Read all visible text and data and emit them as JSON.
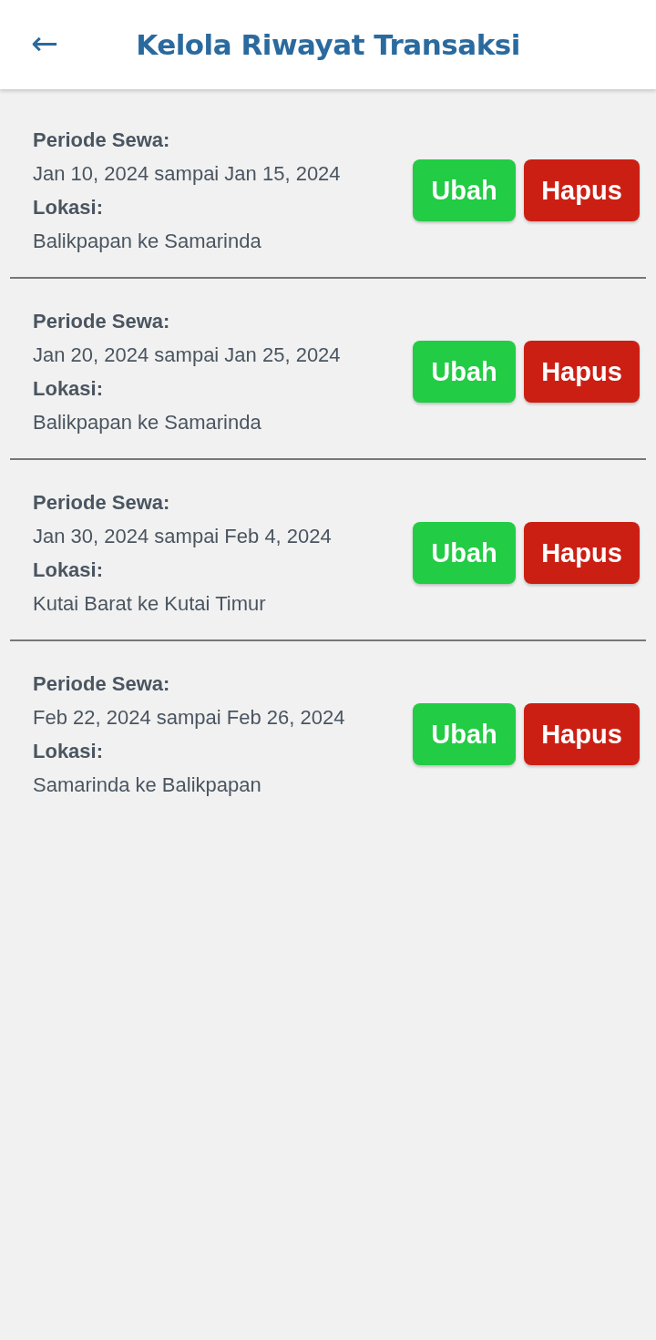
{
  "header": {
    "back_icon": "←",
    "title": "Kelola Riwayat Transaksi"
  },
  "transactions": [
    {
      "period_label": "Periode Sewa:",
      "period": "Jan 10, 2024 sampai Jan 15, 2024",
      "location_label": "Lokasi:",
      "location": "Balikpapan ke Samarinda",
      "edit_button": "Ubah",
      "delete_button": "Hapus"
    },
    {
      "period_label": "Periode Sewa:",
      "period": "Jan 20, 2024 sampai Jan 25, 2024",
      "location_label": "Lokasi:",
      "location": "Balikpapan ke Samarinda",
      "edit_button": "Ubah",
      "delete_button": "Hapus"
    },
    {
      "period_label": "Periode Sewa:",
      "period": "Jan 30, 2024 sampai Feb 4, 2024",
      "location_label": "Lokasi:",
      "location": "Kutai Barat ke Kutai Timur",
      "edit_button": "Ubah",
      "delete_button": "Hapus"
    },
    {
      "period_label": "Periode Sewa:",
      "period": "Feb 22, 2024 sampai Feb 26, 2024",
      "location_label": "Lokasi:",
      "location": "Samarinda ke Balikpapan",
      "edit_button": "Ubah",
      "delete_button": "Hapus"
    }
  ]
}
